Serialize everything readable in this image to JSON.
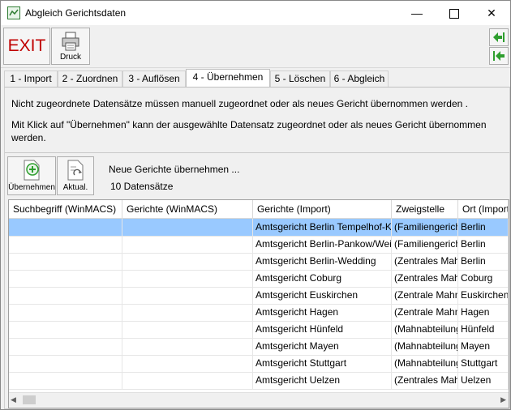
{
  "window": {
    "title": "Abgleich Gerichtsdaten"
  },
  "toolbar": {
    "exit_label": "EXIT",
    "print_label": "Druck"
  },
  "tabs": [
    {
      "label": "1 - Import"
    },
    {
      "label": "2 - Zuordnen"
    },
    {
      "label": "3 - Auflösen"
    },
    {
      "label": "4 - Übernehmen",
      "active": true
    },
    {
      "label": "5 - Löschen"
    },
    {
      "label": "6 - Abgleich"
    }
  ],
  "info": {
    "line1": "Nicht zugeordnete Datensätze müssen manuell zugeordnet oder als neues Gericht übernommen werden .",
    "line2": "Mit Klick auf \"Übernehmen\" kann der ausgewählte Datensatz zugeordnet oder als neues Gericht übernommen werden."
  },
  "actions": {
    "uebernehmen_label": "Übernehmen",
    "aktual_label": "Aktual."
  },
  "status": {
    "title": "Neue Gerichte übernehmen ...",
    "count": "10 Datensätze"
  },
  "table": {
    "columns": [
      "Suchbegriff (WinMACS)",
      "Gerichte (WinMACS)",
      "Gerichte (Import)",
      "Zweigstelle",
      "Ort (Import)"
    ],
    "rows": [
      {
        "suchbegriff": "",
        "gericht_winmacs": "",
        "gericht_import": "Amtsgericht Berlin Tempelhof-Kreuzberg",
        "zweigstelle": "(Familiengericht)",
        "ort": "Berlin"
      },
      {
        "suchbegriff": "",
        "gericht_winmacs": "",
        "gericht_import": "Amtsgericht Berlin-Pankow/Weißensee",
        "zweigstelle": "(Familiengericht)",
        "ort": "Berlin"
      },
      {
        "suchbegriff": "",
        "gericht_winmacs": "",
        "gericht_import": "Amtsgericht Berlin-Wedding",
        "zweigstelle": "(Zentrales Mahngericht)",
        "ort": "Berlin"
      },
      {
        "suchbegriff": "",
        "gericht_winmacs": "",
        "gericht_import": "Amtsgericht Coburg",
        "zweigstelle": "(Zentrales Mahngericht)",
        "ort": "Coburg"
      },
      {
        "suchbegriff": "",
        "gericht_winmacs": "",
        "gericht_import": "Amtsgericht Euskirchen",
        "zweigstelle": "(Zentrale Mahnabteilung)",
        "ort": "Euskirchen"
      },
      {
        "suchbegriff": "",
        "gericht_winmacs": "",
        "gericht_import": "Amtsgericht Hagen",
        "zweigstelle": "(Zentrale Mahnabteilung)",
        "ort": "Hagen"
      },
      {
        "suchbegriff": "",
        "gericht_winmacs": "",
        "gericht_import": "Amtsgericht Hünfeld",
        "zweigstelle": "(Mahnabteilung)",
        "ort": "Hünfeld"
      },
      {
        "suchbegriff": "",
        "gericht_winmacs": "",
        "gericht_import": "Amtsgericht Mayen",
        "zweigstelle": "(Mahnabteilung)",
        "ort": "Mayen"
      },
      {
        "suchbegriff": "",
        "gericht_winmacs": "",
        "gericht_import": "Amtsgericht Stuttgart",
        "zweigstelle": "(Mahnabteilung)",
        "ort": "Stuttgart"
      },
      {
        "suchbegriff": "",
        "gericht_winmacs": "",
        "gericht_import": "Amtsgericht Uelzen",
        "zweigstelle": "(Zentrales Mahngericht)",
        "ort": "Uelzen"
      }
    ],
    "selected_row": 0
  },
  "colors": {
    "selection": "#99c9ff",
    "exit": "#c00000",
    "nav_green": "#2e9e2e"
  }
}
